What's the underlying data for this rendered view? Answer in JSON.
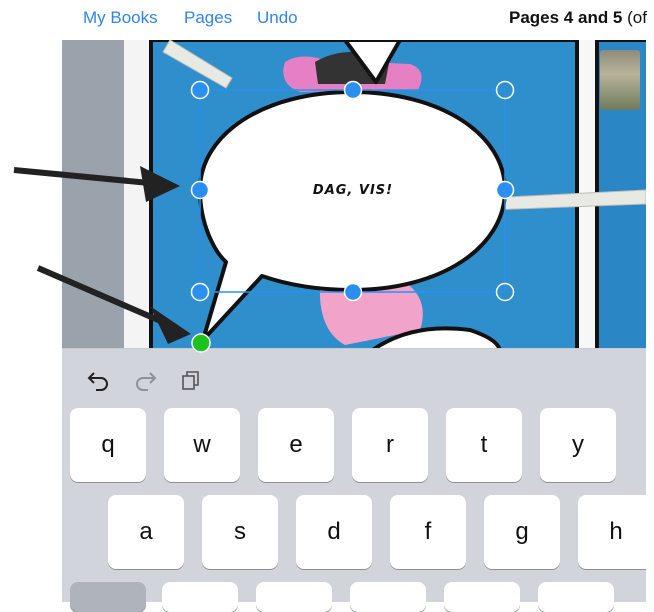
{
  "nav": {
    "my_books": "My Books",
    "pages": "Pages",
    "undo": "Undo",
    "title_bold": "Pages 4 and 5",
    "title_rest": " (of"
  },
  "speech_bubble": {
    "text": "DAG, VIS!"
  },
  "keyboard": {
    "toolbar_icons": [
      "undo-icon",
      "redo-icon",
      "clipboard-icon"
    ],
    "row1": [
      "q",
      "w",
      "e",
      "r",
      "t",
      "y"
    ],
    "row2": [
      "a",
      "s",
      "d",
      "f",
      "g",
      "h"
    ]
  },
  "colors": {
    "accent": "#2f86e8",
    "panel_blue": "#2f8fcd",
    "handle_blue": "#2b8ff0",
    "anchor_green": "#1ec21e"
  }
}
